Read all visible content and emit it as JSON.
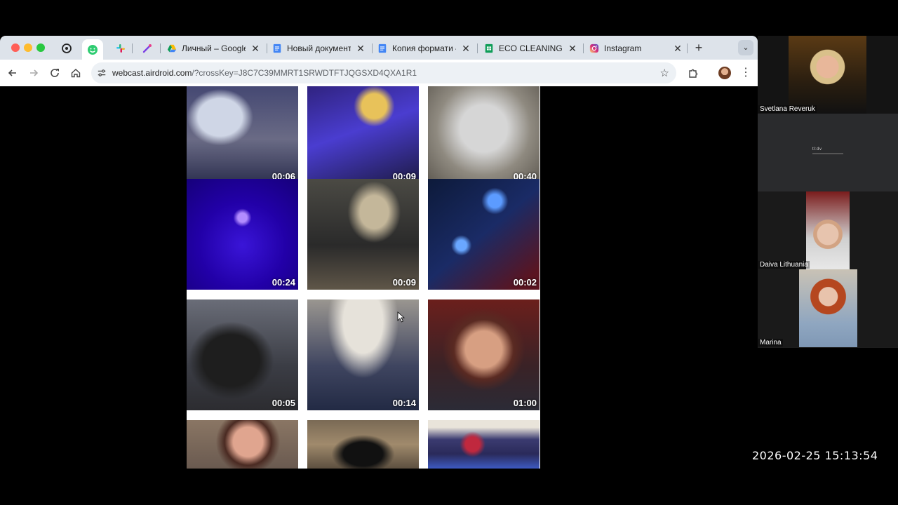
{
  "browser": {
    "tabs": [
      {
        "title": "Личный – Google Д",
        "favicon": "google-drive-icon"
      },
      {
        "title": "Новый документ –",
        "favicon": "google-docs-icon"
      },
      {
        "title": "Копия формати –",
        "favicon": "google-docs-icon"
      },
      {
        "title": "ECO CLEANING – G",
        "favicon": "google-sheets-icon"
      },
      {
        "title": "Instagram",
        "favicon": "instagram-icon"
      }
    ],
    "url_host": "webcast.airdroid.com",
    "url_path": "/?crossKey=J8C7C39MMRT1SRWDTFTJQGSXD4QXA1R1"
  },
  "gallery": {
    "videos": [
      {
        "duration": "00:06"
      },
      {
        "duration": "00:09"
      },
      {
        "duration": "00:40"
      },
      {
        "duration": "00:24"
      },
      {
        "duration": "00:09"
      },
      {
        "duration": "00:02"
      },
      {
        "duration": "00:05"
      },
      {
        "duration": "00:14"
      },
      {
        "duration": "01:00"
      },
      {
        "duration": ""
      },
      {
        "duration": ""
      },
      {
        "duration": ""
      }
    ]
  },
  "participants": [
    {
      "name": "Svetlana Reveruk"
    },
    {
      "name": ""
    },
    {
      "name": "Daiva Lithuania"
    },
    {
      "name": "Marina"
    }
  ],
  "shared_screen_logo": "tl:dv",
  "timestamp": "2026-02-25  15:13:54",
  "colors": {
    "tabbar": "#dde3ea",
    "omnibox": "#edf1f5",
    "docs_blue": "#4285f4",
    "sheets_green": "#0f9d58"
  }
}
